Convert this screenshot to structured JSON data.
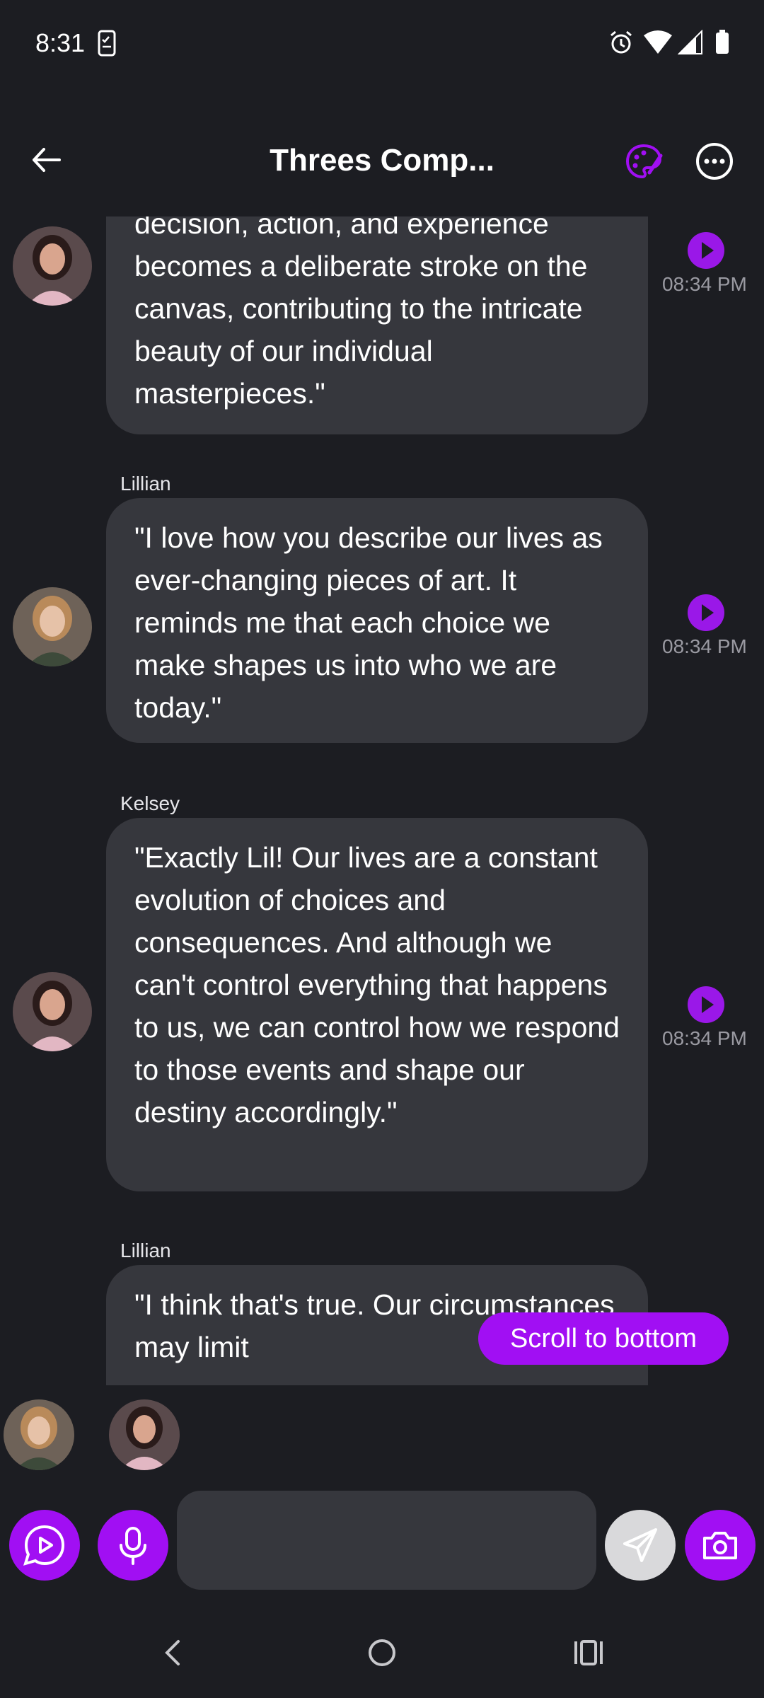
{
  "status_bar": {
    "time": "8:31",
    "icons": [
      "phone-task-icon",
      "alarm-icon",
      "wifi-icon",
      "signal-icon",
      "battery-icon"
    ]
  },
  "header": {
    "title": "Threes Comp...",
    "back_icon": "back-arrow-icon",
    "palette_icon": "palette-icon",
    "more_icon": "more-options-icon",
    "accent_color": "#a10ff3"
  },
  "messages": [
    {
      "sender": "",
      "text": "decision, action, and experience becomes a deliberate stroke on the canvas, contributing to the intricate beauty of our individual masterpieces.\"",
      "time": "08:34 PM",
      "avatar": "kelsey-avatar"
    },
    {
      "sender": "Lillian",
      "text": "\"I love how you describe our lives as ever-changing pieces of art. It reminds me that each choice we make shapes us into who we are today.\"",
      "time": "08:34 PM",
      "avatar": "lillian-avatar"
    },
    {
      "sender": "Kelsey",
      "text": "\"Exactly Lil! Our lives are a constant evolution of choices and consequences. And although we can't control everything that happens to us, we can control how we respond to those events and shape our destiny accordingly.\"",
      "time": "08:34 PM",
      "avatar": "kelsey-avatar"
    },
    {
      "sender": "Lillian",
      "text": "\"I think that's true. Our circumstances may limit",
      "time": "",
      "avatar": "lillian-avatar"
    }
  ],
  "scroll_to_bottom_label": "Scroll to bottom",
  "participants": [
    "lillian-avatar",
    "kelsey-avatar"
  ],
  "composer": {
    "placeholder": "",
    "value": "",
    "buttons": [
      "play-message-icon",
      "microphone-icon",
      "send-icon",
      "camera-icon"
    ]
  },
  "nav_bar": [
    "back-nav-icon",
    "home-nav-icon",
    "recents-nav-icon"
  ],
  "colors": {
    "background": "#1c1d22",
    "bubble": "#36373d",
    "accent": "#a10ff3",
    "timestamp": "#9a9aa2"
  }
}
